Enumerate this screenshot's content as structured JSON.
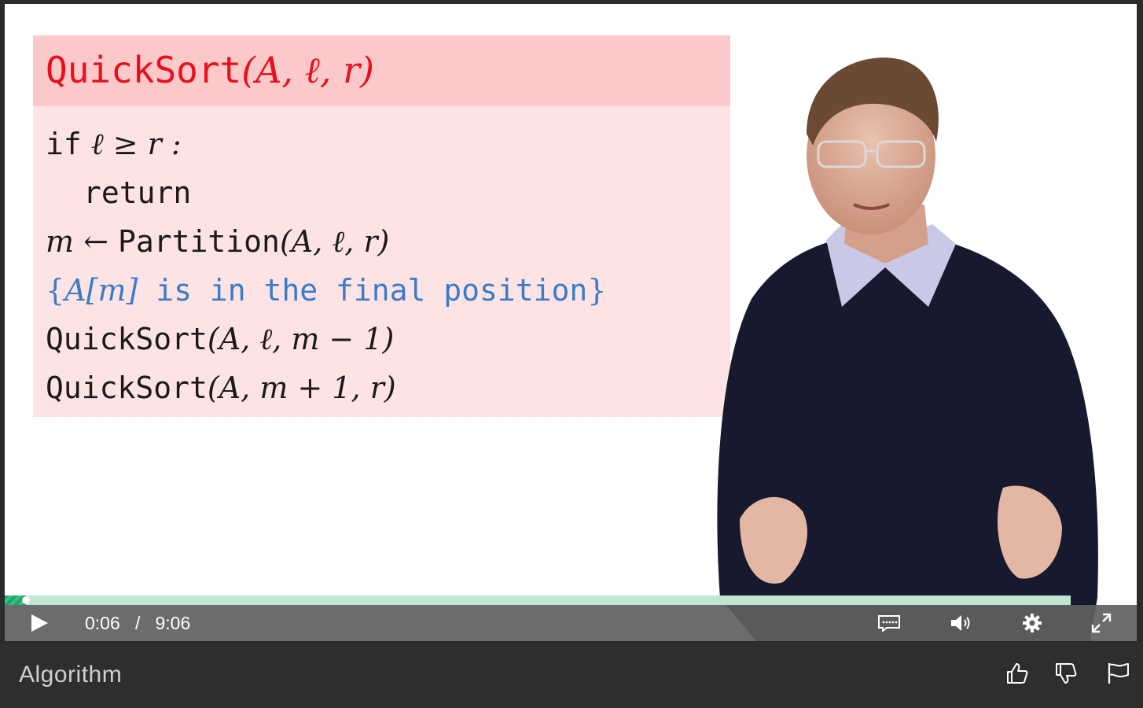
{
  "slide": {
    "title": {
      "fn": "QuickSort",
      "args": "(A, ℓ, r)"
    },
    "lines": [
      {
        "kw": "if",
        "expr": " ℓ ≥ r :"
      },
      {
        "kw": "return"
      },
      {
        "lhs": "m ← ",
        "fn": "Partition",
        "args": "(A, ℓ, r)"
      },
      {
        "open": "{",
        "expr": "A[m]",
        "comment": " is in the final position",
        "close": "}"
      },
      {
        "fn": "QuickSort",
        "args": "(A, ℓ, m − 1)"
      },
      {
        "fn": "QuickSort",
        "args": "(A, m + 1, r)"
      }
    ]
  },
  "player": {
    "current_time": "0:06",
    "separator": "/",
    "duration": "9:06",
    "progress": 0.02,
    "colors": {
      "progress_fill": "#1fa36a",
      "progress_track": "#bfe6d3",
      "control_bar": "#5f5f5f"
    }
  },
  "icons": {
    "play": "play-icon",
    "captions": "captions-icon",
    "volume": "volume-icon",
    "settings": "gear-icon",
    "fullscreen": "fullscreen-icon",
    "like": "thumbs-up-icon",
    "dislike": "thumbs-down-icon",
    "flag": "flag-icon"
  },
  "lecture": {
    "title": "Algorithm"
  }
}
